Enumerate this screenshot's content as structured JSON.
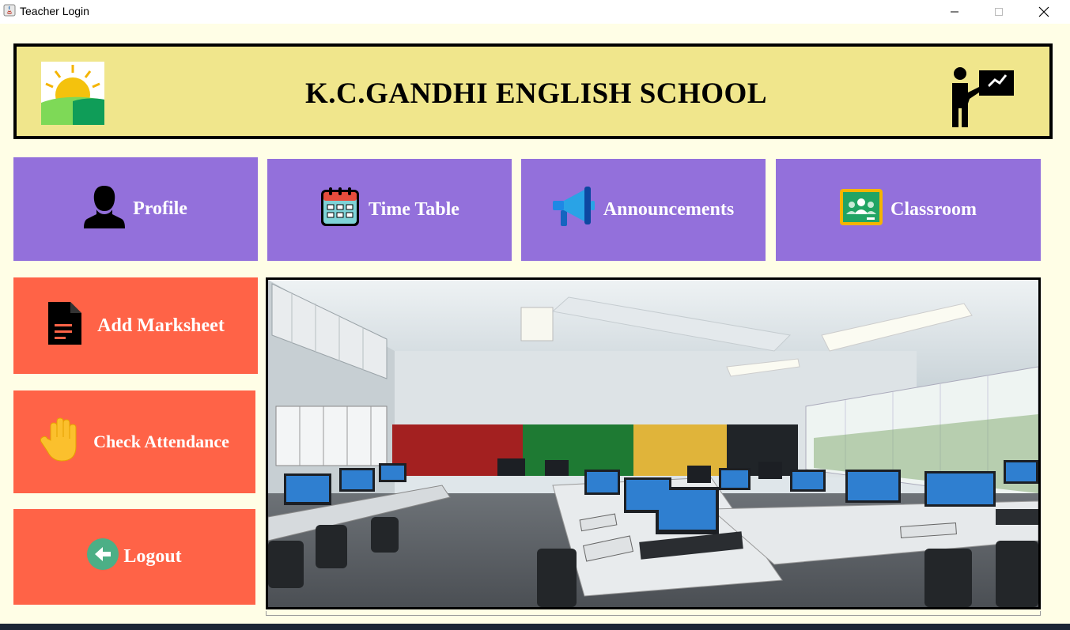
{
  "window": {
    "title": "Teacher Login",
    "controls": [
      "minimize",
      "maximize",
      "close"
    ]
  },
  "header": {
    "school_name": "K.C.GANDHI ENGLISH SCHOOL",
    "background": "#f0e68c"
  },
  "top_menu": [
    {
      "label": "Profile",
      "icon": "user-silhouette-icon"
    },
    {
      "label": "Time Table",
      "icon": "calendar-icon"
    },
    {
      "label": "Announcements",
      "icon": "megaphone-icon"
    },
    {
      "label": "Classroom",
      "icon": "classroom-icon"
    }
  ],
  "side_menu": [
    {
      "label": "Add Marksheet",
      "icon": "document-icon"
    },
    {
      "label": "Check Attendance",
      "icon": "raised-hand-icon"
    },
    {
      "label": "Logout",
      "icon": "back-arrow-icon"
    }
  ],
  "colors": {
    "background": "#fffee6",
    "top_tiles": "#9370db",
    "side_tiles": "#ff6347",
    "header_border": "#000000"
  }
}
